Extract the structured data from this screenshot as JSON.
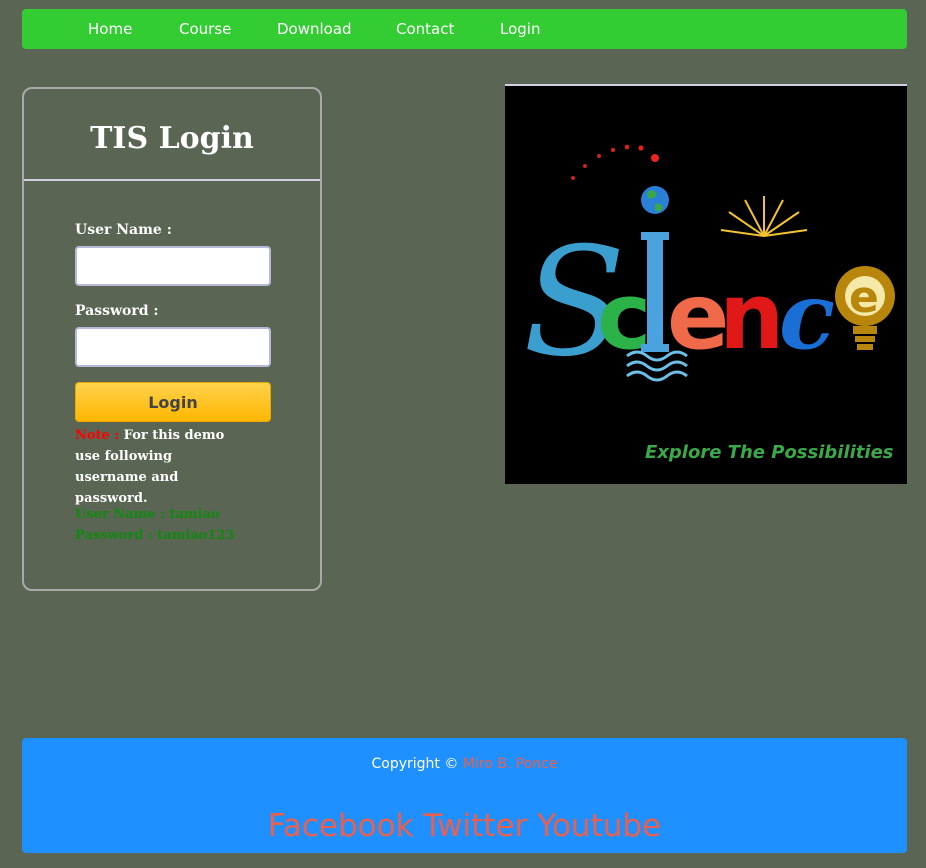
{
  "nav": {
    "items": [
      {
        "label": "Home"
      },
      {
        "label": "Course"
      },
      {
        "label": "Download"
      },
      {
        "label": "Contact"
      },
      {
        "label": "Login"
      }
    ]
  },
  "login": {
    "title": "TIS Login",
    "username_label": "User Name :",
    "username_value": "",
    "password_label": "Password :",
    "password_value": "",
    "button_label": "Login",
    "note_label": "Note :",
    "note_text": " For this demo use following username and password.",
    "demo_username": "User Name : tamiao",
    "demo_password": "Password : tamiao123"
  },
  "hero": {
    "word": "Science",
    "tagline": "Explore The Possibilities"
  },
  "footer": {
    "copyright_text": "Copyright © ",
    "author": "Miro B. Ponce",
    "social": [
      "Facebook",
      "Twitter",
      "Youtube"
    ]
  },
  "colors": {
    "background": "#5a6553",
    "nav": "#33cc33",
    "footer": "#1e90ff",
    "accent_link": "#e9604e",
    "button": "#ffc220",
    "note": "#ff0000",
    "demo_credentials": "#0f8a0f"
  }
}
